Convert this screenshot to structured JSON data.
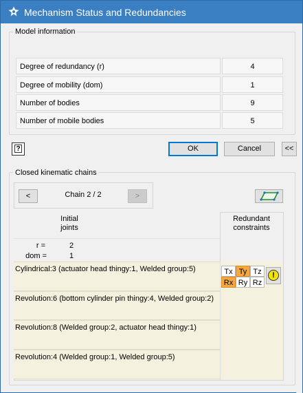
{
  "window": {
    "title": "Mechanism Status and Redundancies"
  },
  "model_info": {
    "group_label": "Model information",
    "rows": [
      {
        "label": "Degree of redundancy (r)",
        "value": "4"
      },
      {
        "label": "Degree of mobility (dom)",
        "value": "1"
      },
      {
        "label": "Number of bodies",
        "value": "9"
      },
      {
        "label": "Number of mobile bodies",
        "value": "5"
      }
    ]
  },
  "buttons": {
    "ok": "OK",
    "cancel": "Cancel",
    "collapse": "<<",
    "help": "?"
  },
  "chains": {
    "group_label": "Closed kinematic chains",
    "prev": "<",
    "next": ">",
    "chain_label": "Chain 2 / 2",
    "header_initial_joints": "Initial\njoints",
    "header_redundant": "Redundant\nconstraints",
    "r_label": "r =",
    "r_value": "2",
    "dom_label": "dom =",
    "dom_value": "1",
    "joints": [
      {
        "text": "Cylindrical:3 (actuator head thingy:1, Welded group:5)",
        "has_dofs": true
      },
      {
        "text": "Revolution:6 (bottom cylinder pin thingy:4, Welded group:2)",
        "has_dofs": false
      },
      {
        "text": "Revolution:8 (Welded group:2, actuator head thingy:1)",
        "has_dofs": false
      },
      {
        "text": "Revolution:4 (Welded group:1, Welded group:5)",
        "has_dofs": false
      }
    ],
    "dofs": {
      "tx": "Tx",
      "ty": "Ty",
      "tz": "Tz",
      "rx": "Rx",
      "ry": "Ry",
      "rz": "Rz",
      "redundant": [
        "Ty",
        "Rx"
      ]
    },
    "warning_glyph": "!"
  },
  "colors": {
    "titlebar": "#3a7fc1",
    "highlight": "#f5a742",
    "row_bg": "#f5f1df",
    "warning": "#f2e600"
  }
}
